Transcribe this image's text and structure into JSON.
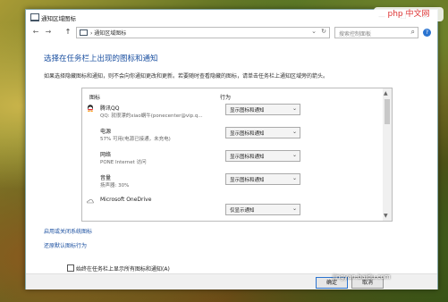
{
  "window": {
    "title": "通知区域图标",
    "controls": {
      "minimize": "—",
      "maximize": "☐",
      "close": "✕"
    }
  },
  "address_bar": {
    "back": "←",
    "forward": "→",
    "up": "↑",
    "breadcrumb": "› 通知区域图标",
    "dropdown": "⌄",
    "refresh": "↻",
    "search_placeholder": "搜索控制面板",
    "search_icon": "⌕",
    "help": "?"
  },
  "heading": "选择在任务栏上出现的图标和通知",
  "description": "如果选择隐藏图标和通知，则不会向你通知更改和更新。若要随时查看隐藏的图标，请单击任务栏上通知区域旁的箭头。",
  "list": {
    "columns": {
      "icon": "图标",
      "behavior": "行为"
    },
    "rows": [
      {
        "icon": "qq-icon",
        "name": "腾讯QQ",
        "subtitle": "QQ: 就很漂的xiao蜗牛(ponecenter@vip.q...",
        "behavior": "显示图标和通知"
      },
      {
        "icon": "battery-icon",
        "name": "电源",
        "subtitle": "57% 可用(电源已接通，未充电)",
        "behavior": "显示图标和通知"
      },
      {
        "icon": "network-icon",
        "name": "网络",
        "subtitle": "PONE Internet 访问",
        "behavior": "显示图标和通知"
      },
      {
        "icon": "volume-icon",
        "name": "音量",
        "subtitle": "扬声器: 30%",
        "behavior": "显示图标和通知"
      },
      {
        "icon": "onedrive-icon",
        "name": "Microsoft OneDrive",
        "subtitle": "",
        "behavior": "仅显示通知"
      }
    ],
    "dropdown_arrow": "⌄",
    "scroll_up": "▲",
    "scroll_down": "▼"
  },
  "links": {
    "system_icons": "启用或关闭系统图标",
    "restore_defaults": "还原默认图标行为"
  },
  "checkbox": {
    "label": "始终在任务栏上显示所有图标和通知(A)",
    "checked": false
  },
  "buttons": {
    "ok": "确定",
    "cancel": "取消"
  },
  "watermarks": {
    "php": "php 中文网",
    "baidu": "jingyan.baidu.com"
  },
  "colors": {
    "accent": "#1a4fa0",
    "close_hover": "#2b74d0"
  }
}
